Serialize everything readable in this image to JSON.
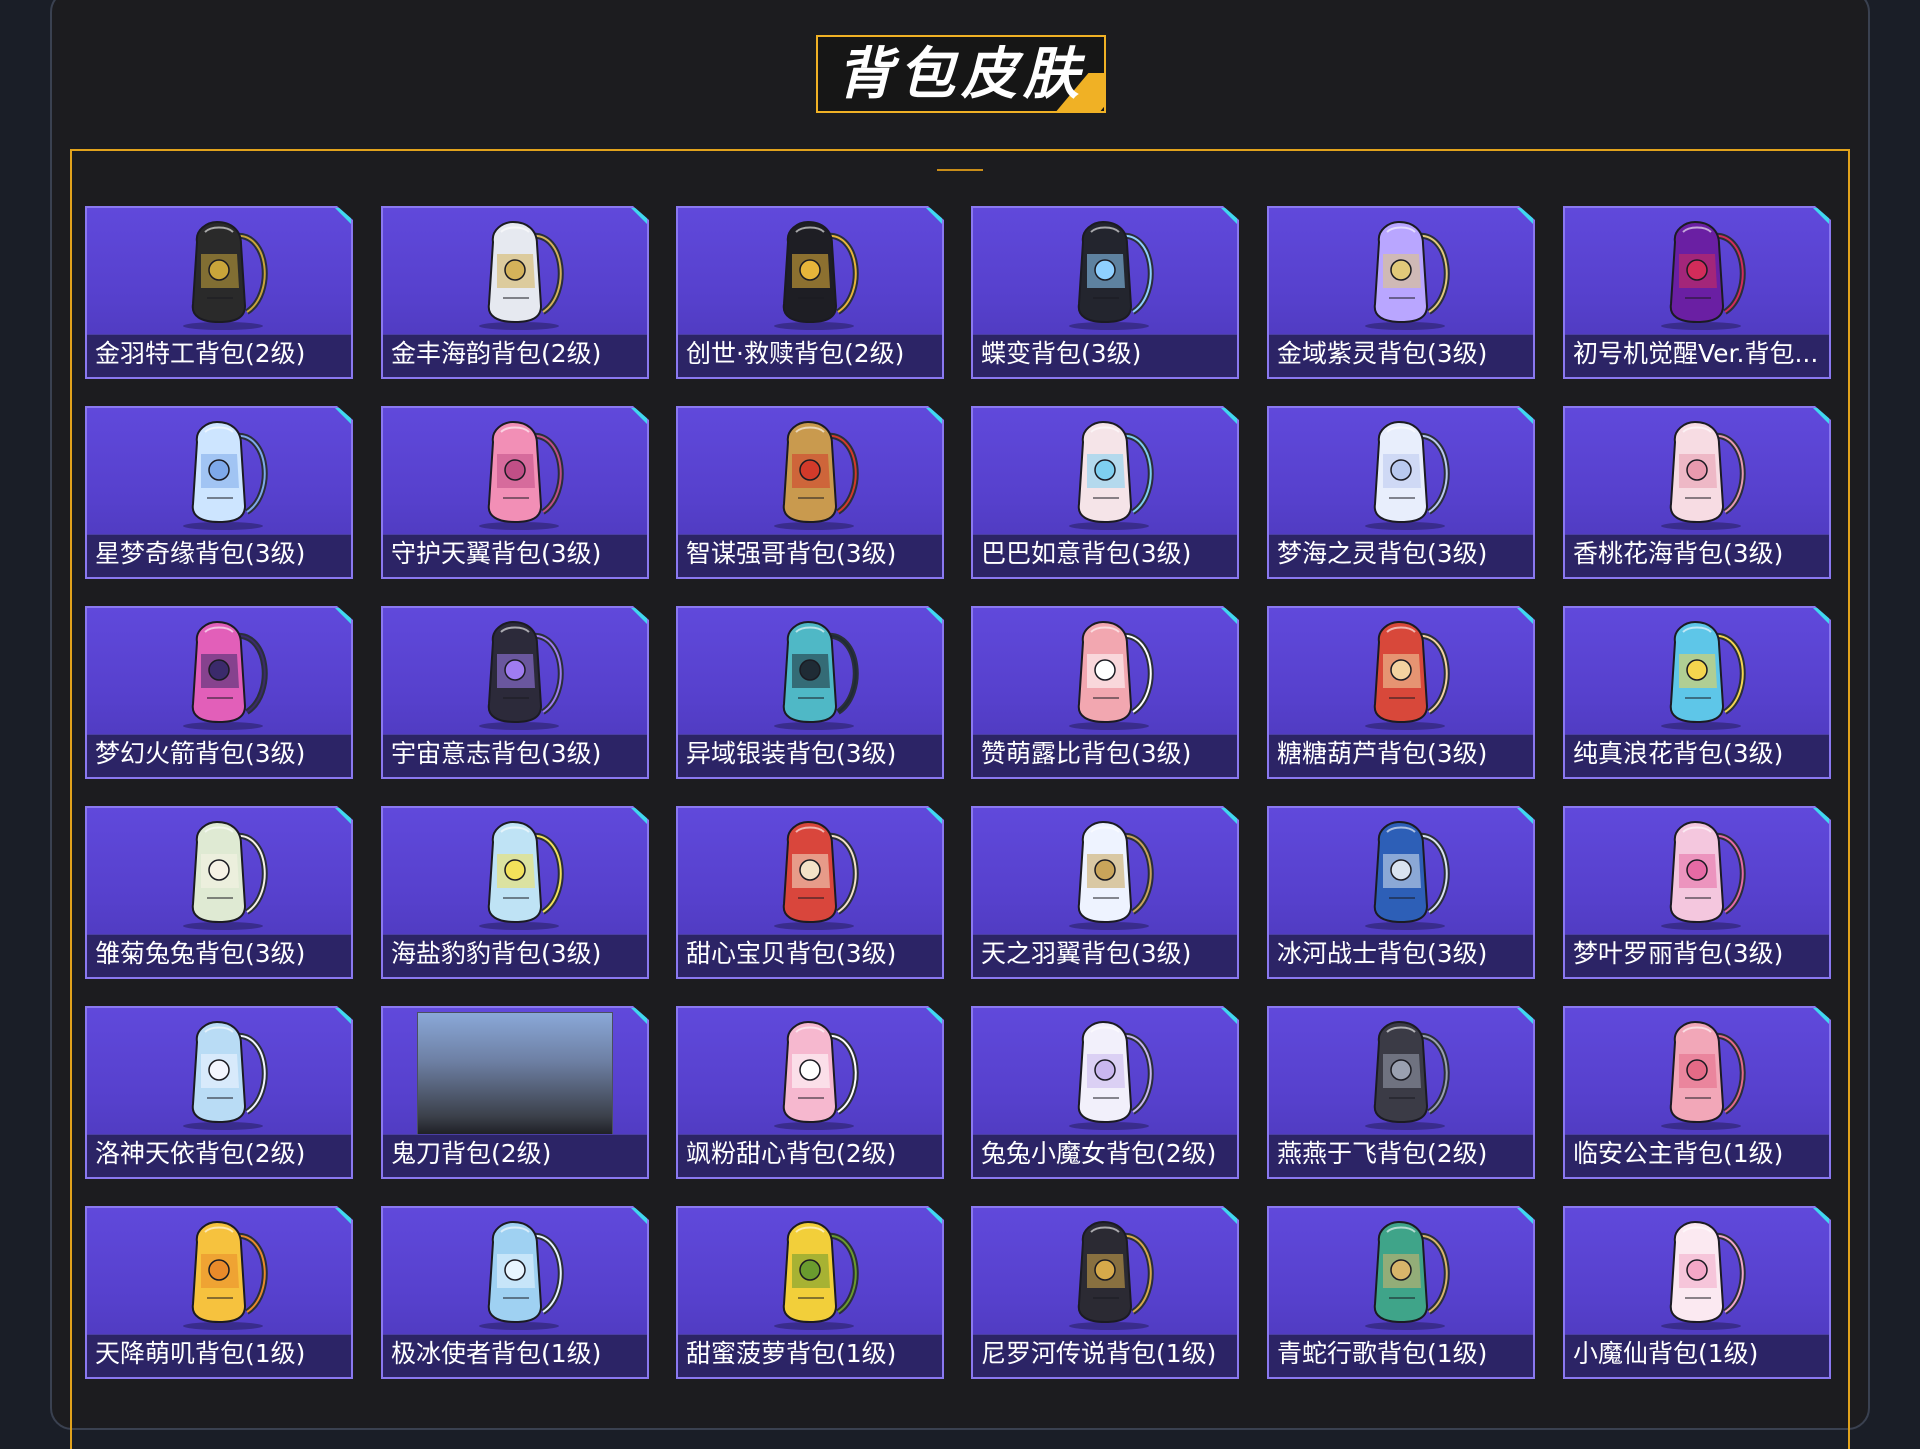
{
  "page": {
    "title": "背包皮肤"
  },
  "colors": {
    "card_bg": "#5a44d3",
    "card_border": "#8a78f0",
    "label_bar": "#2c2466",
    "accent": "#f0b125",
    "corner": "#40d8f0"
  },
  "items": [
    {
      "label": "金羽特工背包(2级)",
      "icon": "black-gold-backpack-icon",
      "c1": "#2a2a2a",
      "c2": "#c9a53a"
    },
    {
      "label": "金丰海韵背包(2级)",
      "icon": "white-gold-shell-backpack-icon",
      "c1": "#e6e9f0",
      "c2": "#d4b25a"
    },
    {
      "label": "创世·救赎背包(2级)",
      "icon": "black-gold-mech-backpack-icon",
      "c1": "#1e1e24",
      "c2": "#e7b53a"
    },
    {
      "label": "蝶变背包(3级)",
      "icon": "black-butterfly-backpack-icon",
      "c1": "#23252e",
      "c2": "#8fd0ff"
    },
    {
      "label": "金域紫灵背包(3级)",
      "icon": "purple-orb-backpack-icon",
      "c1": "#b9a6ff",
      "c2": "#e1c97a"
    },
    {
      "label": "初号机觉醒Ver.背包...",
      "icon": "purple-mech-backpack-icon",
      "c1": "#6a1fa3",
      "c2": "#d22c5a"
    },
    {
      "label": "星梦奇缘背包(3级)",
      "icon": "swan-backpack-icon",
      "c1": "#cde5ff",
      "c2": "#7ea9ea"
    },
    {
      "label": "守护天翼背包(3级)",
      "icon": "pink-wing-backpack-icon",
      "c1": "#f28fb6",
      "c2": "#c04f86"
    },
    {
      "label": "智谋强哥背包(3级)",
      "icon": "bear-sunglasses-backpack-icon",
      "c1": "#c99a4e",
      "c2": "#d23a2a"
    },
    {
      "label": "巴巴如意背包(3级)",
      "icon": "white-rabbit-backpack-icon",
      "c1": "#f5e4e8",
      "c2": "#7ecff0"
    },
    {
      "label": "梦海之灵背包(3级)",
      "icon": "white-shell-backpack-icon",
      "c1": "#e8eefc",
      "c2": "#b9c9ef"
    },
    {
      "label": "香桃花海背包(3级)",
      "icon": "peach-blossom-backpack-icon",
      "c1": "#f7dce3",
      "c2": "#e89aae"
    },
    {
      "label": "梦幻火箭背包(3级)",
      "icon": "pink-rocket-backpack-icon",
      "c1": "#e25fb9",
      "c2": "#3b2a6b"
    },
    {
      "label": "宇宙意志背包(3级)",
      "icon": "dark-crystal-backpack-icon",
      "c1": "#2c2a3a",
      "c2": "#9f7cf0"
    },
    {
      "label": "异域银装背包(3级)",
      "icon": "silver-teal-backpack-icon",
      "c1": "#4fb8c6",
      "c2": "#1f2b35"
    },
    {
      "label": "赞萌露比背包(3级)",
      "icon": "pink-bear-backpack-icon",
      "c1": "#f2a7b0",
      "c2": "#ffffff"
    },
    {
      "label": "糖糖葫芦背包(3级)",
      "icon": "red-gourd-backpack-icon",
      "c1": "#d8483a",
      "c2": "#f3d3a0"
    },
    {
      "label": "纯真浪花背包(3级)",
      "icon": "blue-drink-backpack-icon",
      "c1": "#5ec6e8",
      "c2": "#f4d54e"
    },
    {
      "label": "雏菊兔兔背包(3级)",
      "icon": "daisy-bunny-backpack-icon",
      "c1": "#dfead3",
      "c2": "#f6f2e6"
    },
    {
      "label": "海盐豹豹背包(3级)",
      "icon": "blue-seal-backpack-icon",
      "c1": "#bfe3f5",
      "c2": "#f2e15a"
    },
    {
      "label": "甜心宝贝背包(3级)",
      "icon": "cake-backpack-icon",
      "c1": "#d9463c",
      "c2": "#f3e2c8"
    },
    {
      "label": "天之羽翼背包(3级)",
      "icon": "white-wing-backpack-icon",
      "c1": "#eef3ff",
      "c2": "#c9a45a"
    },
    {
      "label": "冰河战士背包(3级)",
      "icon": "blue-warrior-backpack-icon",
      "c1": "#2d5fb7",
      "c2": "#d9e3f0"
    },
    {
      "label": "梦叶罗丽背包(3级)",
      "icon": "heart-crystal-backpack-icon",
      "c1": "#f4c7de",
      "c2": "#e66aa4"
    },
    {
      "label": "洛神天依背包(2级)",
      "icon": "blue-bow-backpack-icon",
      "c1": "#b9dcf5",
      "c2": "#f3f6ff"
    },
    {
      "label": "鬼刀背包(2级)",
      "icon": "placeholder-image",
      "c1": "#8aa8d8",
      "c2": "#2b2e36"
    },
    {
      "label": "飒粉甜心背包(2级)",
      "icon": "pink-bunny-backpack-icon",
      "c1": "#f6b8cf",
      "c2": "#ffffff"
    },
    {
      "label": "兔兔小魔女背包(2级)",
      "icon": "white-bunny-backpack-icon",
      "c1": "#f2f0fb",
      "c2": "#c9b7ef"
    },
    {
      "label": "燕燕于飞背包(2级)",
      "icon": "dark-pendant-backpack-icon",
      "c1": "#3b3b46",
      "c2": "#9aa0b0"
    },
    {
      "label": "临安公主背包(1级)",
      "icon": "pink-flower-backpack-icon",
      "c1": "#f2a7b8",
      "c2": "#e46a86"
    },
    {
      "label": "天降萌叽背包(1级)",
      "icon": "yellow-backpack-icon",
      "c1": "#f6c23e",
      "c2": "#e98a2a"
    },
    {
      "label": "极冰使者背包(1级)",
      "icon": "ice-wolf-backpack-icon",
      "c1": "#9fd1f2",
      "c2": "#e8f5ff"
    },
    {
      "label": "甜蜜菠萝背包(1级)",
      "icon": "pineapple-backpack-icon",
      "c1": "#f2cf3a",
      "c2": "#6a9b2e"
    },
    {
      "label": "尼罗河传说背包(1级)",
      "icon": "egyptian-backpack-icon",
      "c1": "#2b2a33",
      "c2": "#d6a94a"
    },
    {
      "label": "青蛇行歌背包(1级)",
      "icon": "green-round-backpack-icon",
      "c1": "#3fa489",
      "c2": "#d8b56a"
    },
    {
      "label": "小魔仙背包(1级)",
      "icon": "white-pink-bunny-backpack-icon",
      "c1": "#fbe9f1",
      "c2": "#f3a7c7"
    }
  ]
}
